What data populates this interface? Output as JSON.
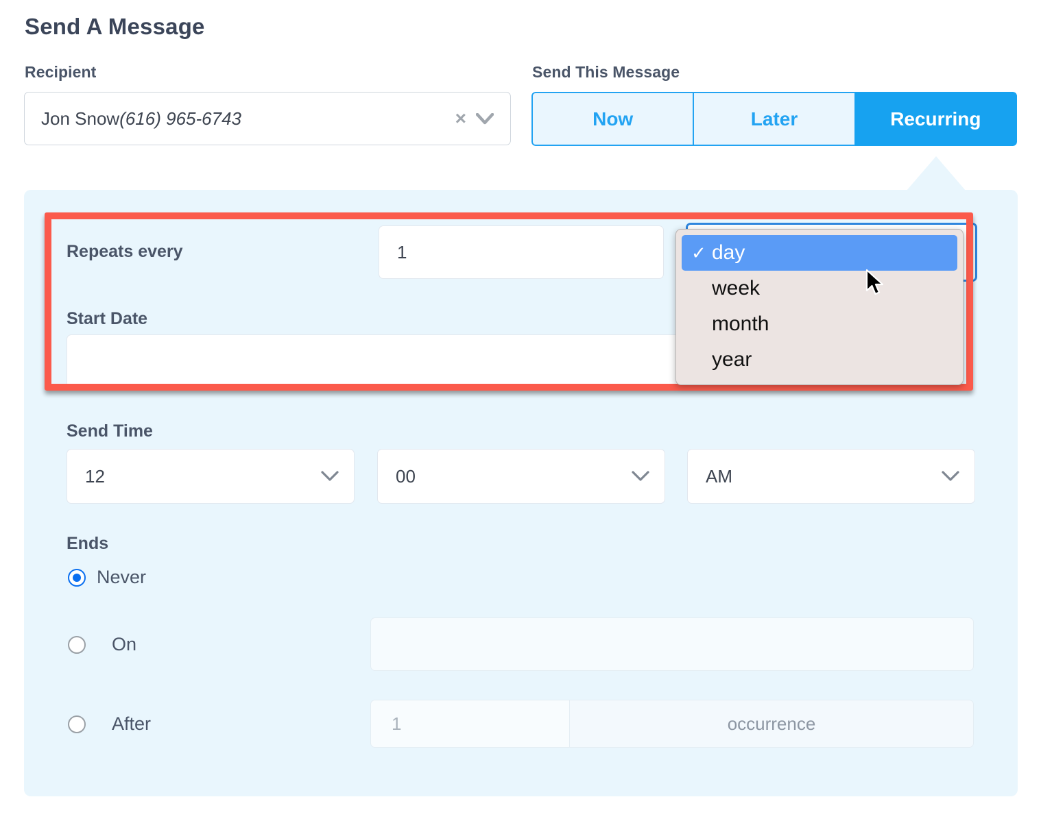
{
  "page_title": "Send A Message",
  "recipient": {
    "label": "Recipient",
    "name": "Jon Snow",
    "phone": "(616) 965-6743",
    "clear_icon": "×"
  },
  "send_this_message": {
    "label": "Send This Message",
    "tabs": [
      {
        "label": "Now",
        "active": false
      },
      {
        "label": "Later",
        "active": false
      },
      {
        "label": "Recurring",
        "active": true
      }
    ]
  },
  "recurring": {
    "repeats_every": {
      "label": "Repeats every",
      "interval_value": "1",
      "unit_selected": "day",
      "unit_options": [
        "day",
        "week",
        "month",
        "year"
      ]
    },
    "start_date": {
      "label": "Start Date",
      "value": ""
    },
    "send_time": {
      "label": "Send Time",
      "hour": "12",
      "minute": "00",
      "meridiem": "AM"
    },
    "ends": {
      "label": "Ends",
      "options": [
        {
          "label": "Never",
          "selected": true
        },
        {
          "label": "On",
          "selected": false
        },
        {
          "label": "After",
          "selected": false
        }
      ],
      "on_date_value": "",
      "after_count": "1",
      "after_unit": "occurrence"
    }
  },
  "colors": {
    "accent_blue": "#17a2f0",
    "tab_inactive_bg": "#eaf6fe",
    "panel_bg": "#e9f6fd",
    "highlight_red": "#fb5a4b",
    "dropdown_bg": "#ece4e2",
    "dropdown_selected": "#5a9bf6",
    "radio_selected": "#0a6ff0",
    "heading_text": "#3b4559"
  }
}
